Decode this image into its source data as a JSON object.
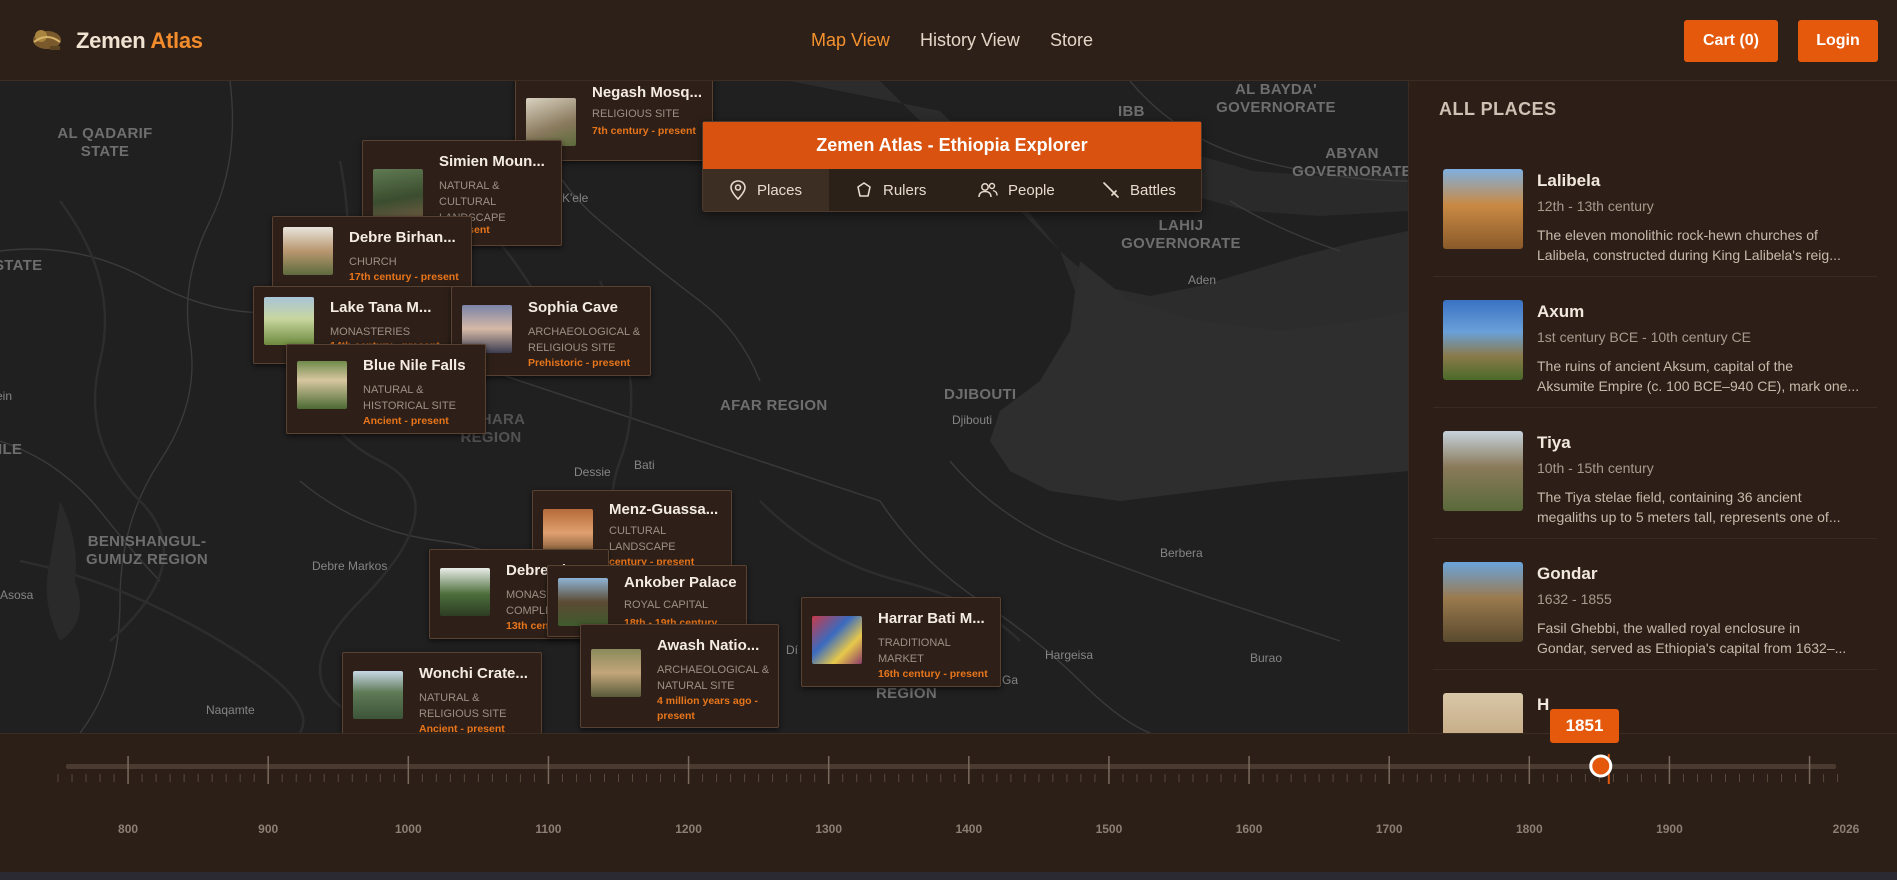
{
  "header": {
    "brand_main": "Zemen ",
    "brand_accent": "Atlas",
    "nav": [
      "Map View",
      "History View",
      "Store"
    ],
    "cart_label": "Cart (0)",
    "login_label": "Login",
    "colors": {
      "accent": "#e5590c",
      "active_nav": "#f5922f"
    }
  },
  "explorer": {
    "title": "Zemen Atlas - Ethiopia Explorer",
    "tabs": [
      {
        "label": "Places",
        "icon": "map-pin-icon"
      },
      {
        "label": "Rulers",
        "icon": "crown-icon"
      },
      {
        "label": "People",
        "icon": "people-icon"
      },
      {
        "label": "Battles",
        "icon": "sword-icon"
      }
    ]
  },
  "map": {
    "regions": [
      "AL QADARIF STATE",
      "STATE",
      "BENISHANGUL-GUMUZ REGION",
      "AFAR REGION",
      "AMHARA REGION",
      "DJIBOUTI",
      "AL BAYDA' GOVERNORATE",
      "ABYAN GOVERNORATE",
      "LAHIJ GOVERNORATE",
      "IBB",
      "REGION",
      "N",
      "ILE"
    ],
    "cities": [
      "Dessie",
      "Bati",
      "Debre Markos",
      "Asosa",
      "Naqamte",
      "Aden",
      "Djibouti",
      "Berbera",
      "Hargeisa",
      "Burao",
      "K'ele",
      "Dí",
      "Ga",
      "ein"
    ],
    "cards": [
      {
        "title": "Negash Mosq...",
        "type": "RELIGIOUS SITE",
        "date": "7th century - present"
      },
      {
        "title": "Simien Moun...",
        "type": "NATURAL & CULTURAL LANDSCAPE",
        "date": "t - present"
      },
      {
        "title": "Debre Birhan...",
        "type": "CHURCH",
        "date": "17th century - present"
      },
      {
        "title": "Lake Tana M...",
        "type": "MONASTERIES",
        "date": "14th century - present"
      },
      {
        "title": "Sophia Cave",
        "type": "ARCHAEOLOGICAL & RELIGIOUS SITE",
        "date": "Prehistoric - present"
      },
      {
        "title": "Blue Nile Falls",
        "type": "NATURAL & HISTORICAL SITE",
        "date": "Ancient - present"
      },
      {
        "title": "Menz-Guassa...",
        "type": "CULTURAL LANDSCAPE",
        "date": "century - present"
      },
      {
        "title": "Debre Li...",
        "type": "MONAST... COMPLE...",
        "date": "13th cen..."
      },
      {
        "title": "Ankober Palace",
        "type": "ROYAL CAPITAL",
        "date": "18th - 19th century"
      },
      {
        "title": "Harrar Bati M...",
        "type": "TRADITIONAL MARKET",
        "date": "16th century - present"
      },
      {
        "title": "Awash Natio...",
        "type": "ARCHAEOLOGICAL & NATURAL SITE",
        "date": "4 million years ago - present"
      },
      {
        "title": "Wonchi Crate...",
        "type": "NATURAL & RELIGIOUS SITE",
        "date": "Ancient - present"
      }
    ]
  },
  "sidebar": {
    "title": "ALL PLACES",
    "places": [
      {
        "name": "Lalibela",
        "date": "12th - 13th century",
        "desc1": "The eleven monolithic rock-hewn churches of",
        "desc2": "Lalibela, constructed during King Lalibela's reig..."
      },
      {
        "name": "Axum",
        "date": "1st century BCE - 10th century CE",
        "desc1": "The ruins of ancient Aksum, capital of the",
        "desc2": "Aksumite Empire (c. 100 BCE–940 CE), mark one..."
      },
      {
        "name": "Tiya",
        "date": "10th - 15th century",
        "desc1": "The Tiya stelae field, containing 36 ancient",
        "desc2": "megaliths up to 5 meters tall, represents one of..."
      },
      {
        "name": "Gondar",
        "date": "1632 - 1855",
        "desc1": "Fasil Ghebbi, the walled royal enclosure in",
        "desc2": "Gondar, served as Ethiopia's capital from 1632–..."
      },
      {
        "name": "H",
        "date": "",
        "desc1": "",
        "desc2": ""
      }
    ]
  },
  "timeline": {
    "labels": [
      "800",
      "900",
      "1000",
      "1100",
      "1200",
      "1300",
      "1400",
      "1500",
      "1600",
      "1700",
      "1800",
      "1900",
      "2026"
    ],
    "current_year": "1851",
    "min_year": 750,
    "max_year": 2026
  }
}
